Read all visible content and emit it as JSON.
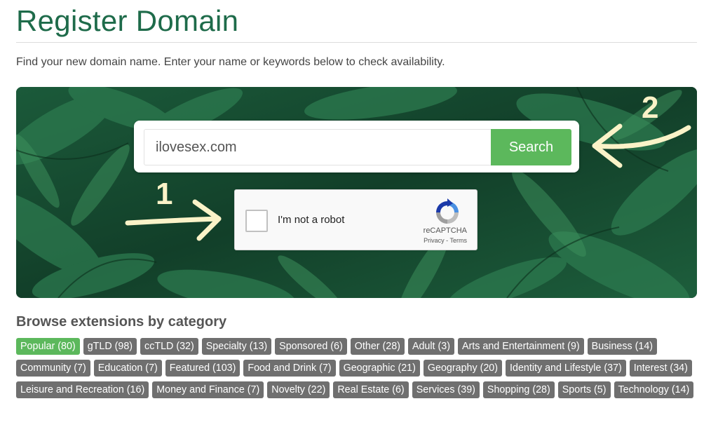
{
  "page": {
    "title": "Register Domain",
    "intro": "Find your new domain name. Enter your name or keywords below to check availability."
  },
  "search": {
    "value": "ilovesex.com",
    "button_label": "Search"
  },
  "captcha": {
    "label": "I'm not a robot",
    "brand": "reCAPTCHA",
    "links": "Privacy - Terms"
  },
  "annotations": {
    "step1": "1",
    "step2": "2",
    "color": "#fbf3c8"
  },
  "browse": {
    "title": "Browse extensions by category",
    "categories": [
      {
        "label": "Popular (80)",
        "active": true
      },
      {
        "label": "gTLD (98)"
      },
      {
        "label": "ccTLD (32)"
      },
      {
        "label": "Specialty (13)"
      },
      {
        "label": "Sponsored (6)"
      },
      {
        "label": "Other (28)"
      },
      {
        "label": "Adult (3)"
      },
      {
        "label": "Arts and Entertainment (9)"
      },
      {
        "label": "Business (14)"
      },
      {
        "label": "Community (7)"
      },
      {
        "label": "Education (7)"
      },
      {
        "label": "Featured (103)"
      },
      {
        "label": "Food and Drink (7)"
      },
      {
        "label": "Geographic (21)"
      },
      {
        "label": "Geography (20)"
      },
      {
        "label": "Identity and Lifestyle (37)"
      },
      {
        "label": "Interest (34)"
      },
      {
        "label": "Leisure and Recreation (16)"
      },
      {
        "label": "Money and Finance (7)"
      },
      {
        "label": "Novelty (22)"
      },
      {
        "label": "Real Estate (6)"
      },
      {
        "label": "Services (39)"
      },
      {
        "label": "Shopping (28)"
      },
      {
        "label": "Sports (5)"
      },
      {
        "label": "Technology (14)"
      }
    ]
  },
  "colors": {
    "brand_green": "#1e6b4a",
    "button_green": "#5cb85c",
    "tag_gray": "#6f6f6f"
  },
  "icons": {
    "captcha_logo": "recaptcha-icon",
    "arrows": "arrow-right-icon"
  }
}
